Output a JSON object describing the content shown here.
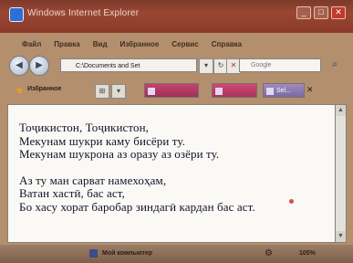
{
  "window": {
    "title": "Windows Internet Explorer"
  },
  "menu": {
    "items": [
      "Файл",
      "Правка",
      "Вид",
      "Избранное",
      "Сервис",
      "Справка"
    ]
  },
  "address": {
    "value": "C:\\Documents and Set",
    "search_placeholder": "Google"
  },
  "favorites": {
    "label": "Избранное"
  },
  "tabs": [
    {
      "label": ""
    },
    {
      "label": ""
    },
    {
      "label": "Sel..."
    }
  ],
  "poem": {
    "lines": [
      "Тоҷикистон, Тоҷикистон,",
      "Мекунам шукри каму бисёри ту.",
      "Мекунам шукрона аз оразу аз озёри ту."
    ],
    "lines2": [
      "Аз ту ман сарват намехоҳам,",
      "Ватан хастӣ, бас аст,",
      "Бо хасу хорат баробар зиндагӣ кардан бас аст."
    ]
  },
  "status": {
    "computer_label": "Мой компьютер",
    "zoom": "105%"
  },
  "colors": {
    "titlebar": "#8a3a2a",
    "content_bg": "#faf9f5",
    "tab_pink": "#b63b65",
    "tab_purple": "#8f7cb5"
  }
}
